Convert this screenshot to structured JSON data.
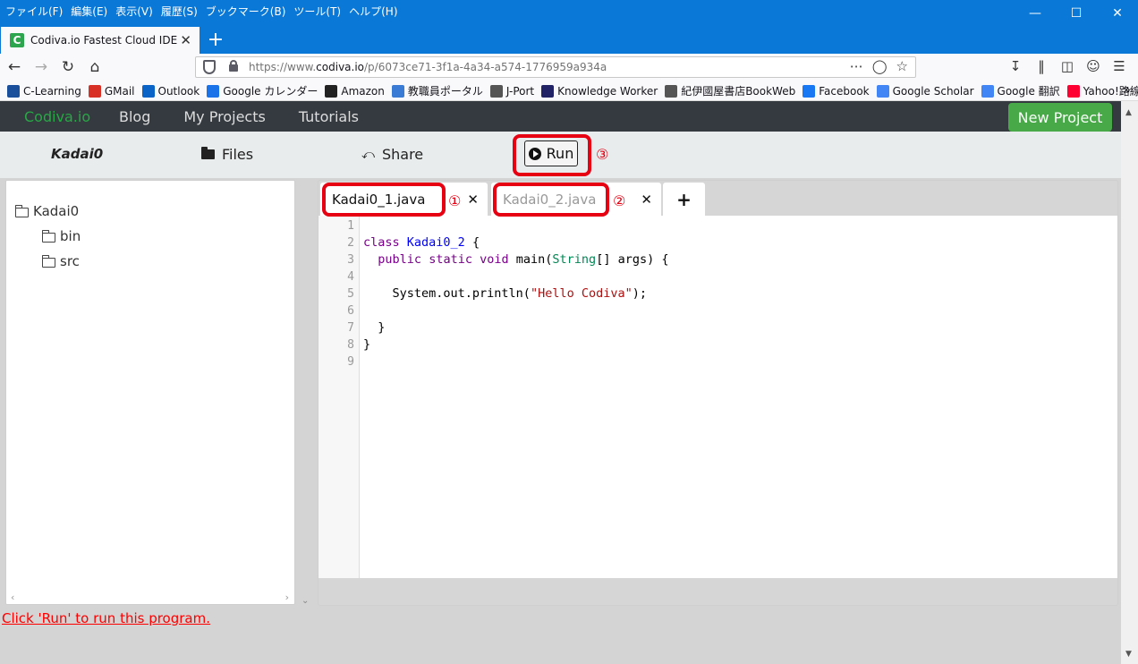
{
  "browser": {
    "menus": [
      "ファイル(F)",
      "編集(E)",
      "表示(V)",
      "履歴(S)",
      "ブックマーク(B)",
      "ツール(T)",
      "ヘルプ(H)"
    ],
    "tab_title": "Codiva.io Fastest Cloud IDE",
    "url_prefix": "https://www.",
    "url_domain": "codiva.io",
    "url_path": "/p/6073ce71-3f1a-4a34-a574-1776959a934a",
    "bookmarks": [
      {
        "label": "C-Learning",
        "icon": "c-learning-icon",
        "color": "#1a4f9c"
      },
      {
        "label": "GMail",
        "icon": "gmail-icon",
        "color": "#d93025"
      },
      {
        "label": "Outlook",
        "icon": "outlook-icon",
        "color": "#0a64c8"
      },
      {
        "label": "Google カレンダー",
        "icon": "calendar-icon",
        "color": "#1a73e8"
      },
      {
        "label": "Amazon",
        "icon": "amazon-icon",
        "color": "#222222"
      },
      {
        "label": "教職員ポータル",
        "icon": "portal-icon",
        "color": "#3a7bd5"
      },
      {
        "label": "J-Port",
        "icon": "globe-icon",
        "color": "#555555"
      },
      {
        "label": "Knowledge Worker",
        "icon": "kw-icon",
        "color": "#222266"
      },
      {
        "label": "紀伊國屋書店BookWeb",
        "icon": "globe-icon",
        "color": "#555555"
      },
      {
        "label": "Facebook",
        "icon": "facebook-icon",
        "color": "#1877f2"
      },
      {
        "label": "Google Scholar",
        "icon": "scholar-icon",
        "color": "#4285f4"
      },
      {
        "label": "Google 翻訳",
        "icon": "translate-icon",
        "color": "#4285f4"
      },
      {
        "label": "Yahoo!路線",
        "icon": "yahoo-icon",
        "color": "#ff0033"
      }
    ]
  },
  "app": {
    "brand": "Codiva.io",
    "nav_links": [
      "Blog",
      "My Projects",
      "Tutorials"
    ],
    "new_project": "New Project",
    "project_name": "Kadai0",
    "files_label": "Files",
    "share_label": "Share",
    "run_label": "Run",
    "tree": {
      "root": "Kadai0",
      "children": [
        "bin",
        "src"
      ]
    },
    "tabs": [
      {
        "label": "Kadai0_1.java",
        "active": true
      },
      {
        "label": "Kadai0_2.java",
        "active": false
      }
    ],
    "add_tab": "+",
    "code_lines": [
      "",
      "class Kadai0_2 {",
      "  public static void main(String[] args) {",
      "",
      "    System.out.println(\"Hello Codiva\");",
      "",
      "  }",
      "}",
      ""
    ],
    "status_message": "Click 'Run' to run this program."
  },
  "annotations": {
    "marker_1": "①",
    "marker_2": "②",
    "marker_3": "③",
    "color": "#e60012"
  }
}
